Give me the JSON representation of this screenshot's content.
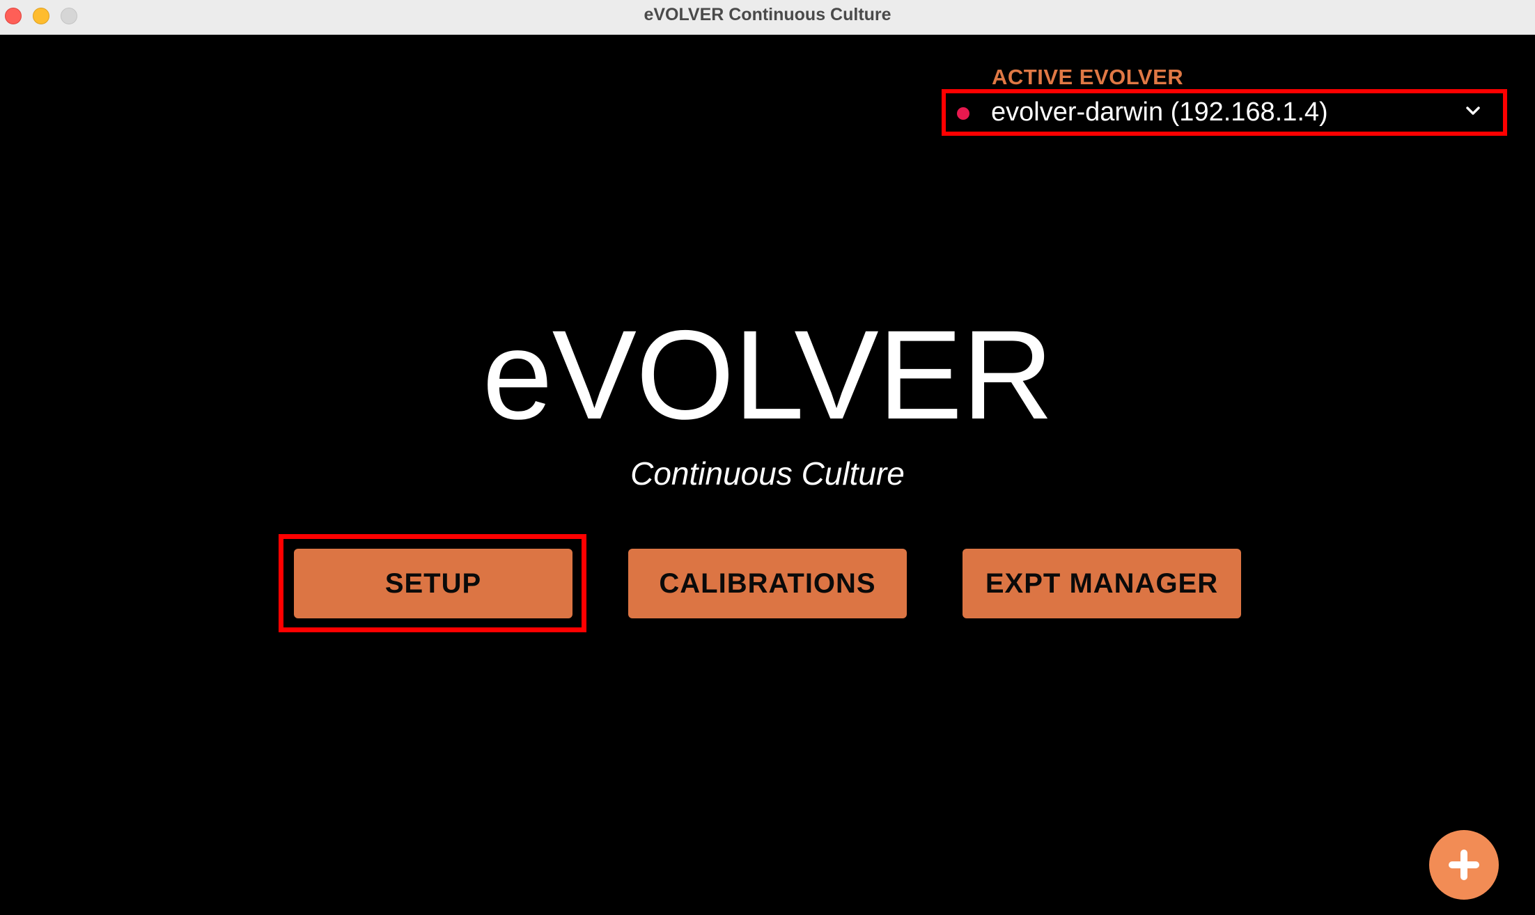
{
  "window": {
    "title": "eVOLVER Continuous Culture"
  },
  "active_evolver": {
    "label": "ACTIVE EVOLVER",
    "selected": "evolver-darwin (192.168.1.4)",
    "status_color": "#e8194f",
    "dropdown_icon": "chevron-down-icon"
  },
  "hero": {
    "title": "eVOLVER",
    "subtitle": "Continuous Culture"
  },
  "buttons": {
    "setup": "SETUP",
    "calibrations": "CALIBRATIONS",
    "expt_manager": "EXPT MANAGER"
  },
  "fab": {
    "icon": "plus-icon"
  },
  "colors": {
    "accent": "#dc7544",
    "label_orange": "#e07845",
    "highlight": "#ff0000",
    "background": "#000000"
  }
}
